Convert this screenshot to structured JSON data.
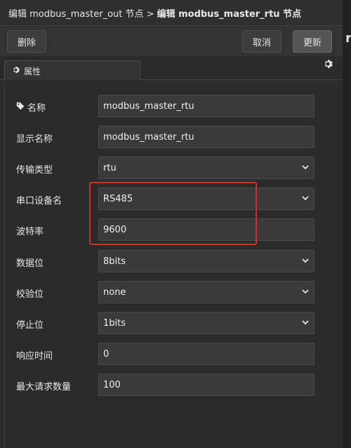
{
  "titlebar": {
    "parent": "编辑 modbus_master_out 节点 >",
    "current": "编辑 modbus_master_rtu 节点"
  },
  "right_peek": "r",
  "toolbar": {
    "delete_label": "删除",
    "cancel_label": "取消",
    "update_label": "更新"
  },
  "tabs": {
    "properties_label": "属性"
  },
  "icons": {
    "tab": "gear-icon",
    "settings": "gear-icon",
    "name": "tag-icon",
    "select": "chevron-down-icon"
  },
  "colors": {
    "highlight": "#d4301e"
  },
  "form": {
    "name": {
      "label": "名称",
      "value": "modbus_master_rtu"
    },
    "display_name": {
      "label": "显示名称",
      "value": "modbus_master_rtu"
    },
    "transport": {
      "label": "传输类型",
      "value": "rtu"
    },
    "serial_device": {
      "label": "串口设备名",
      "value": "RS485"
    },
    "baud_rate": {
      "label": "波特率",
      "value": "9600"
    },
    "data_bits": {
      "label": "数据位",
      "value": "8bits"
    },
    "parity": {
      "label": "校验位",
      "value": "none"
    },
    "stop_bits": {
      "label": "停止位",
      "value": "1bits"
    },
    "response_time": {
      "label": "响应时间",
      "value": "0"
    },
    "max_requests": {
      "label": "最大请求数量",
      "value": "100"
    }
  }
}
